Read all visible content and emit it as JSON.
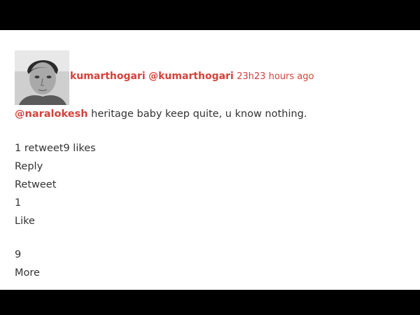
{
  "colors": {
    "accent": "#d4423c",
    "text": "#333333",
    "frame": "#000000",
    "panel": "#ffffff"
  },
  "tweet": {
    "display_name": "kumarthogari",
    "handle": "@kumarthogari",
    "timestamp": "23h23 hours ago",
    "mention": "@naralokesh",
    "text": " heritage baby keep quite, u know nothing.",
    "stats": "1 retweet9 likes",
    "actions": {
      "reply": "Reply",
      "retweet": "Retweet",
      "retweet_count": "1",
      "like": "Like",
      "like_count": "9",
      "more": "More"
    }
  },
  "icons": {
    "avatar": "profile-photo"
  }
}
